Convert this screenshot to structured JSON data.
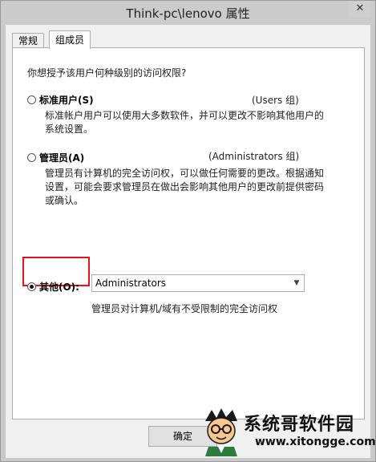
{
  "window": {
    "title": "Think-pc\\lenovo 属性",
    "close_glyph": "✕"
  },
  "tabs": [
    {
      "label": "常规",
      "active": false
    },
    {
      "label": "组成员",
      "active": true
    }
  ],
  "panel": {
    "question": "你想授予该用户何种级别的访问权限?",
    "standard": {
      "label": "标准用户(S)",
      "group": "(Users 组)",
      "desc": "标准帐户用户可以使用大多数软件，并可以更改不影响其他用户的系统设置。",
      "checked": false
    },
    "admin": {
      "label": "管理员(A)",
      "group": "(Administrators 组)",
      "desc": "管理员有计算机的完全访问权，可以做任何需要的更改。根据通知设置，可能会要求管理员在做出会影响其他用户的更改前提供密码或确认。",
      "checked": false
    },
    "other": {
      "label": "其他(O):",
      "checked": true,
      "select_value": "Administrators",
      "select_desc": "管理员对计算机/域有不受限制的完全访问权"
    }
  },
  "buttons": {
    "ok_label": "确定"
  },
  "watermark": {
    "text": "系统哥软件园",
    "url": "www.xitongge.com"
  },
  "colors": {
    "highlight": "#e8131b",
    "panel_bg": "#ffffff",
    "client_bg": "#f0f0f0"
  }
}
